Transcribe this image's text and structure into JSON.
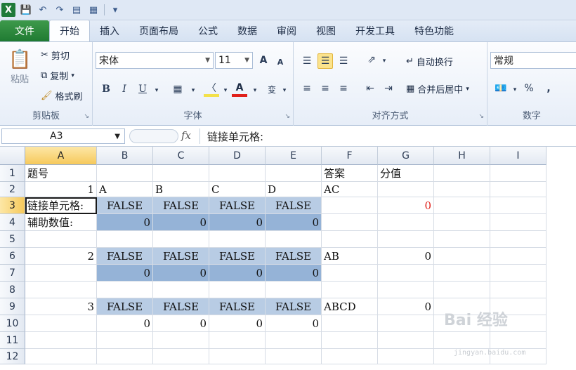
{
  "qat": {
    "app_icon": "X"
  },
  "tabs": [
    "文件",
    "开始",
    "插入",
    "页面布局",
    "公式",
    "数据",
    "审阅",
    "视图",
    "开发工具",
    "特色功能"
  ],
  "ribbon": {
    "clipboard": {
      "paste": "粘贴",
      "cut": "剪切",
      "copy": "复制",
      "format_painter": "格式刷",
      "label": "剪贴板"
    },
    "font": {
      "name": "宋体",
      "size": "11",
      "bold": "B",
      "italic": "I",
      "underline": "U",
      "label": "字体",
      "grow": "A",
      "shrink": "A",
      "wen": "变"
    },
    "alignment": {
      "wrap": "自动换行",
      "merge": "合并后居中",
      "label": "对齐方式"
    },
    "number": {
      "format": "常规",
      "percent": "%",
      "comma": ",",
      "label": "数字"
    }
  },
  "formula_bar": {
    "name_box": "A3",
    "fx": "fx",
    "content": "链接单元格:"
  },
  "columns": [
    "A",
    "B",
    "C",
    "D",
    "E",
    "F",
    "G",
    "H",
    "I"
  ],
  "rows": [
    "1",
    "2",
    "3",
    "4",
    "5",
    "6",
    "7",
    "8",
    "9",
    "10",
    "11",
    "12"
  ],
  "cells": {
    "A1": "题号",
    "F1": "答案",
    "G1": "分值",
    "A2": "1",
    "B2": "A",
    "C2": "B",
    "D2": "C",
    "E2": "D",
    "F2": "AC",
    "A3": "链接单元格:",
    "B3": "FALSE",
    "C3": "FALSE",
    "D3": "FALSE",
    "E3": "FALSE",
    "G3": "0",
    "A4": "辅助数值:",
    "B4": "0",
    "C4": "0",
    "D4": "0",
    "E4": "0",
    "A6": "2",
    "B6": "FALSE",
    "C6": "FALSE",
    "D6": "FALSE",
    "E6": "FALSE",
    "F6": "AB",
    "G6": "0",
    "B7": "0",
    "C7": "0",
    "D7": "0",
    "E7": "0",
    "A9": "3",
    "B9": "FALSE",
    "C9": "FALSE",
    "D9": "FALSE",
    "E9": "FALSE",
    "F9": "ABCD",
    "G9": "0",
    "B10": "0",
    "C10": "0",
    "D10": "0",
    "E10": "0"
  },
  "watermark": {
    "brand": "Bai 经验",
    "url": "jingyan.baidu.com"
  },
  "colors": {
    "fill_light": "#b8cce4",
    "fill_dark": "#95b3d7",
    "red_text": "#e0201a",
    "file_tab": "#2a8a3c"
  }
}
